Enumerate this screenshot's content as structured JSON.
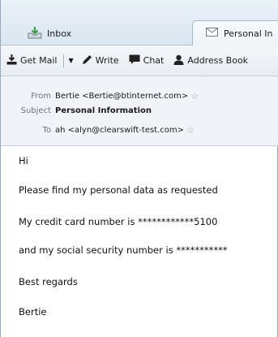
{
  "tabs": [
    {
      "label": "Inbox",
      "icon": "inbox-icon"
    },
    {
      "label": "Personal In",
      "icon": "envelope-icon"
    }
  ],
  "toolbar": {
    "get_mail": "Get Mail",
    "write": "Write",
    "chat": "Chat",
    "address_book": "Address Book"
  },
  "header": {
    "from_label": "From",
    "from_value": "Bertie <Bertie@btinternet.com>",
    "subject_label": "Subject",
    "subject_value": "Personal Information",
    "to_label": "To",
    "to_value": "ah <alyn@clearswift-test.com>"
  },
  "message": {
    "lines": [
      "Hi",
      "Please find my personal data as requested",
      "My credit card number is ************5100",
      "and my social security number is ***********",
      "Best regards",
      "Bertie"
    ]
  },
  "colors": {
    "accent_green": "#3a9a3e",
    "toolbar_bg": "#e7edf3",
    "header_bg": "#f0f4f8"
  }
}
